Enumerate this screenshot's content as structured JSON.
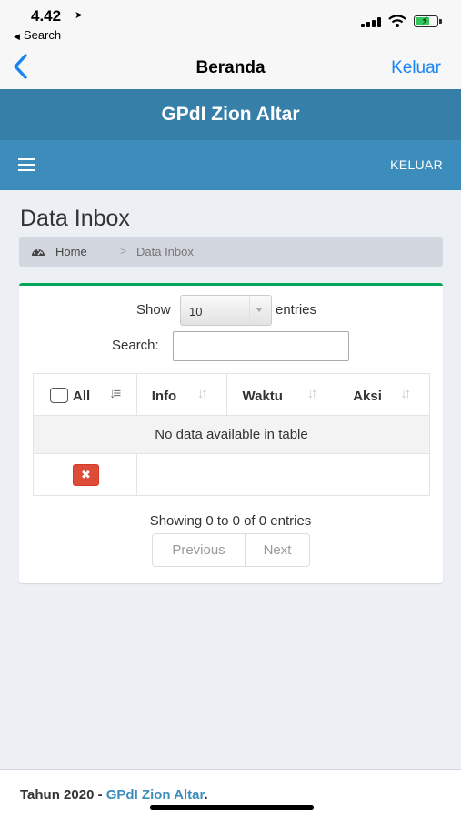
{
  "status_bar": {
    "time": "4.42",
    "back_app": "Search"
  },
  "nav": {
    "title": "Beranda",
    "right_action": "Keluar"
  },
  "site": {
    "name": "GPdI Zion Altar",
    "logout_link": "KELUAR"
  },
  "page": {
    "title": "Data Inbox"
  },
  "breadcrumb": {
    "home": "Home",
    "separator": ">",
    "current": "Data Inbox"
  },
  "datatable": {
    "show_label": "Show",
    "entries_value": "10",
    "entries_label": "entries",
    "search_label": "Search:",
    "search_value": "",
    "columns": [
      "All",
      "Info",
      "Waktu",
      "Aksi"
    ],
    "empty_message": "No data available in table",
    "info": "Showing 0 to 0 of 0 entries",
    "pagination": {
      "previous": "Previous",
      "next": "Next"
    }
  },
  "footer": {
    "prefix": "Tahun 2020 - ",
    "link": "GPdI Zion Altar",
    "suffix": "."
  },
  "colors": {
    "header_dark": "#367fa9",
    "header_light": "#3c8dbc",
    "box_border": "#00a65a",
    "danger": "#dd4b39",
    "ios_link": "#1a84f0"
  }
}
